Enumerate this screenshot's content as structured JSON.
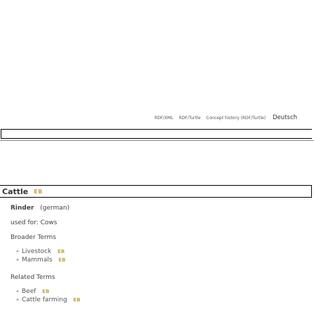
{
  "header": {
    "links": [
      "RDF/XML",
      "RDF/Turtle",
      "Concept history (RDF/Turtle)"
    ],
    "language": "Deutsch"
  },
  "concept": {
    "title": "Cattle",
    "badge": "EB",
    "pref_label": "Rinder",
    "pref_lang": "(german)",
    "used_for": "used for: Cows",
    "broader_heading": "Broader Terms",
    "broader": [
      {
        "label": "Livestock",
        "badge": "EB"
      },
      {
        "label": "Mammals",
        "badge": "EB"
      }
    ],
    "related_heading": "Related Terms",
    "related": [
      {
        "label": "Beef",
        "badge": "EB"
      },
      {
        "label": "Cattle farming",
        "badge": "EB"
      }
    ]
  }
}
